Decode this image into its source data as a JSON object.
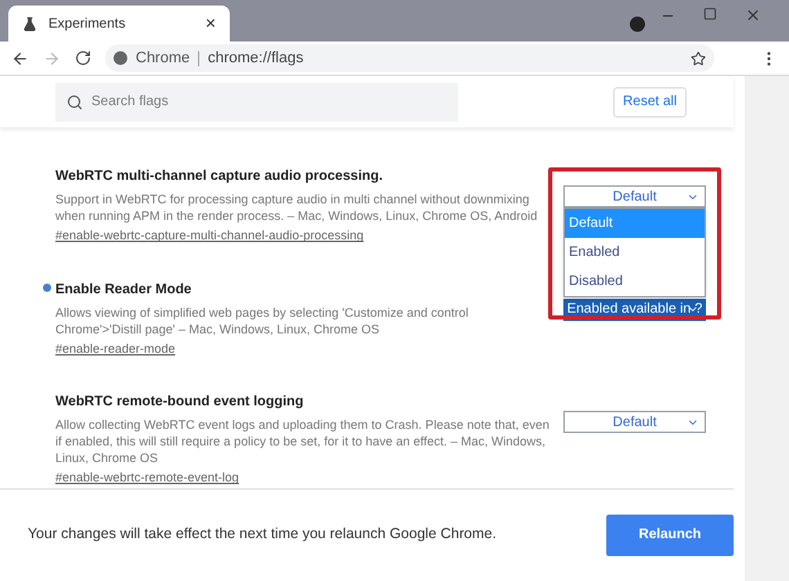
{
  "tab": {
    "title": "Experiments",
    "close": "×"
  },
  "address_bar": {
    "site": "Chrome",
    "url": "chrome://flags"
  },
  "search": {
    "placeholder": "Search flags"
  },
  "reset_button": "Reset all",
  "flags": [
    {
      "title": "WebRTC multi-channel capture audio processing.",
      "description": "Support in WebRTC for processing capture audio in multi channel without downmixing when running APM in the render process. – Mac, Windows, Linux, Chrome OS, Android",
      "link": "#enable-webrtc-capture-multi-channel-audio-processing",
      "modified": false,
      "select": {
        "value": "Default",
        "highlighted": false,
        "open": true,
        "options": [
          {
            "label": "Default",
            "selected": true
          },
          {
            "label": "Enabled",
            "selected": false
          },
          {
            "label": "Disabled",
            "selected": false
          }
        ]
      }
    },
    {
      "title": "Enable Reader Mode",
      "description": "Allows viewing of simplified web pages by selecting 'Customize and control Chrome'>'Distill page' – Mac, Windows, Linux, Chrome OS",
      "link": "#enable-reader-mode",
      "modified": true,
      "select": {
        "value": "Enabled available in ?",
        "highlighted": true,
        "open": false
      }
    },
    {
      "title": "WebRTC remote-bound event logging",
      "description": "Allow collecting WebRTC event logs and uploading them to Crash. Please note that, even if enabled, this will still require a policy to be set, for it to have an effect. – Mac, Windows, Linux, Chrome OS",
      "link": "#enable-webrtc-remote-event-log",
      "modified": false,
      "select": {
        "value": "Default",
        "highlighted": false,
        "open": false
      }
    }
  ],
  "footer": {
    "message": "Your changes will take effect the next time you relaunch Google Chrome.",
    "button": "Relaunch"
  }
}
